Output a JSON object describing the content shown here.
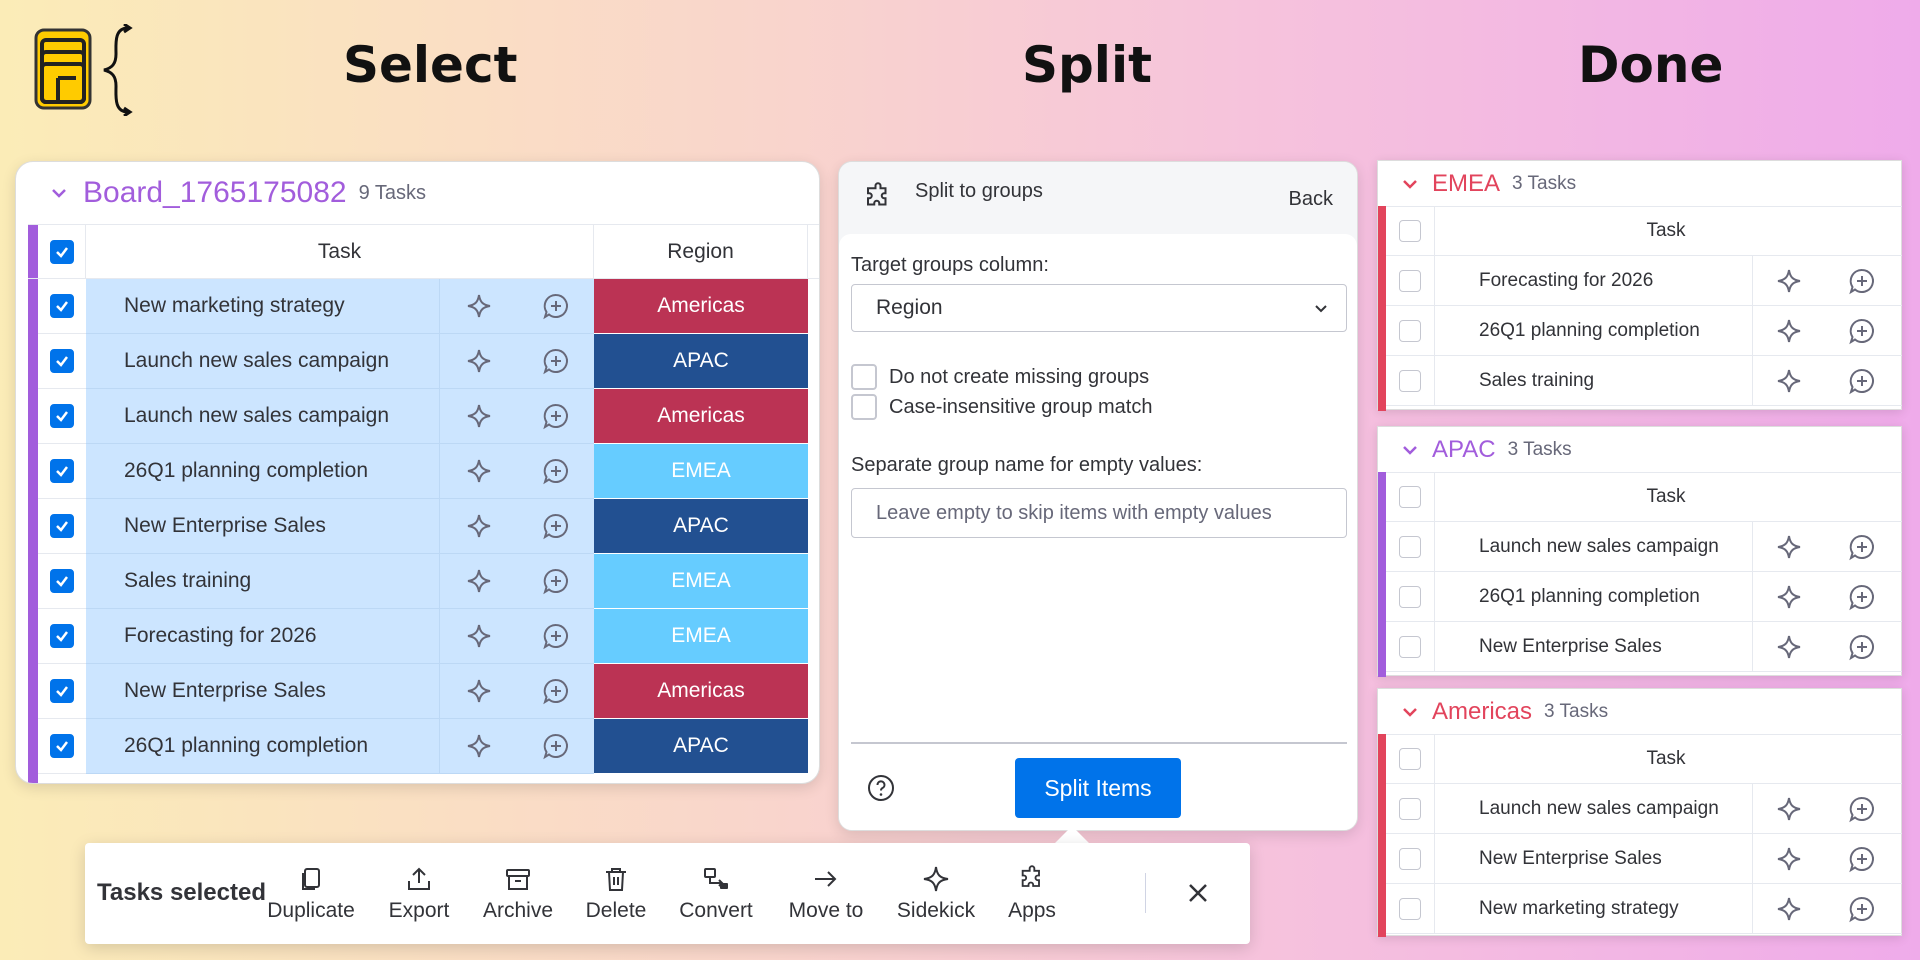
{
  "headings": {
    "select": "Select",
    "split": "Split",
    "done": "Done"
  },
  "board": {
    "title": "Board_1765175082",
    "count": "9 Tasks",
    "columns": {
      "task": "Task",
      "region": "Region"
    },
    "rows": [
      {
        "task": "New marketing strategy",
        "region": "Americas",
        "color": "#bb3354"
      },
      {
        "task": "Launch new sales campaign",
        "region": "APAC",
        "color": "#225091"
      },
      {
        "task": "Launch new sales campaign",
        "region": "Americas",
        "color": "#bb3354"
      },
      {
        "task": "26Q1 planning completion",
        "region": "EMEA",
        "color": "#66ccff"
      },
      {
        "task": "New Enterprise Sales",
        "region": "APAC",
        "color": "#225091"
      },
      {
        "task": "Sales training",
        "region": "EMEA",
        "color": "#66ccff"
      },
      {
        "task": "Forecasting for 2026",
        "region": "EMEA",
        "color": "#66ccff"
      },
      {
        "task": "New Enterprise Sales",
        "region": "Americas",
        "color": "#bb3354"
      },
      {
        "task": "26Q1 planning completion",
        "region": "APAC",
        "color": "#225091"
      }
    ]
  },
  "split": {
    "title": "Split to groups",
    "back": "Back",
    "target_label": "Target groups column:",
    "target_value": "Region",
    "opt_missing": "Do not create missing groups",
    "opt_case": "Case-insensitive group match",
    "empty_label": "Separate group name for empty values:",
    "empty_placeholder": "Leave empty to skip items with empty values",
    "submit": "Split Items"
  },
  "toolbar": {
    "label": "Tasks selected",
    "buttons": [
      "Duplicate",
      "Export",
      "Archive",
      "Delete",
      "Convert",
      "Move to",
      "Sidekick",
      "Apps"
    ]
  },
  "groups": [
    {
      "name": "EMEA",
      "count": "3 Tasks",
      "color": "#e2445c",
      "col": "Task",
      "rows": [
        "Forecasting for 2026",
        "26Q1 planning completion",
        "Sales training"
      ]
    },
    {
      "name": "APAC",
      "count": "3 Tasks",
      "color": "#a25ddc",
      "col": "Task",
      "rows": [
        "Launch new sales campaign",
        "26Q1 planning completion",
        "New Enterprise Sales"
      ]
    },
    {
      "name": "Americas",
      "count": "3 Tasks",
      "color": "#e2445c",
      "col": "Task",
      "rows": [
        "Launch new sales campaign",
        "New Enterprise Sales",
        "New marketing strategy"
      ]
    }
  ],
  "colors": {
    "accent": "#0073ea",
    "board": "#a25ddc",
    "selected_row": "#cce5ff"
  }
}
